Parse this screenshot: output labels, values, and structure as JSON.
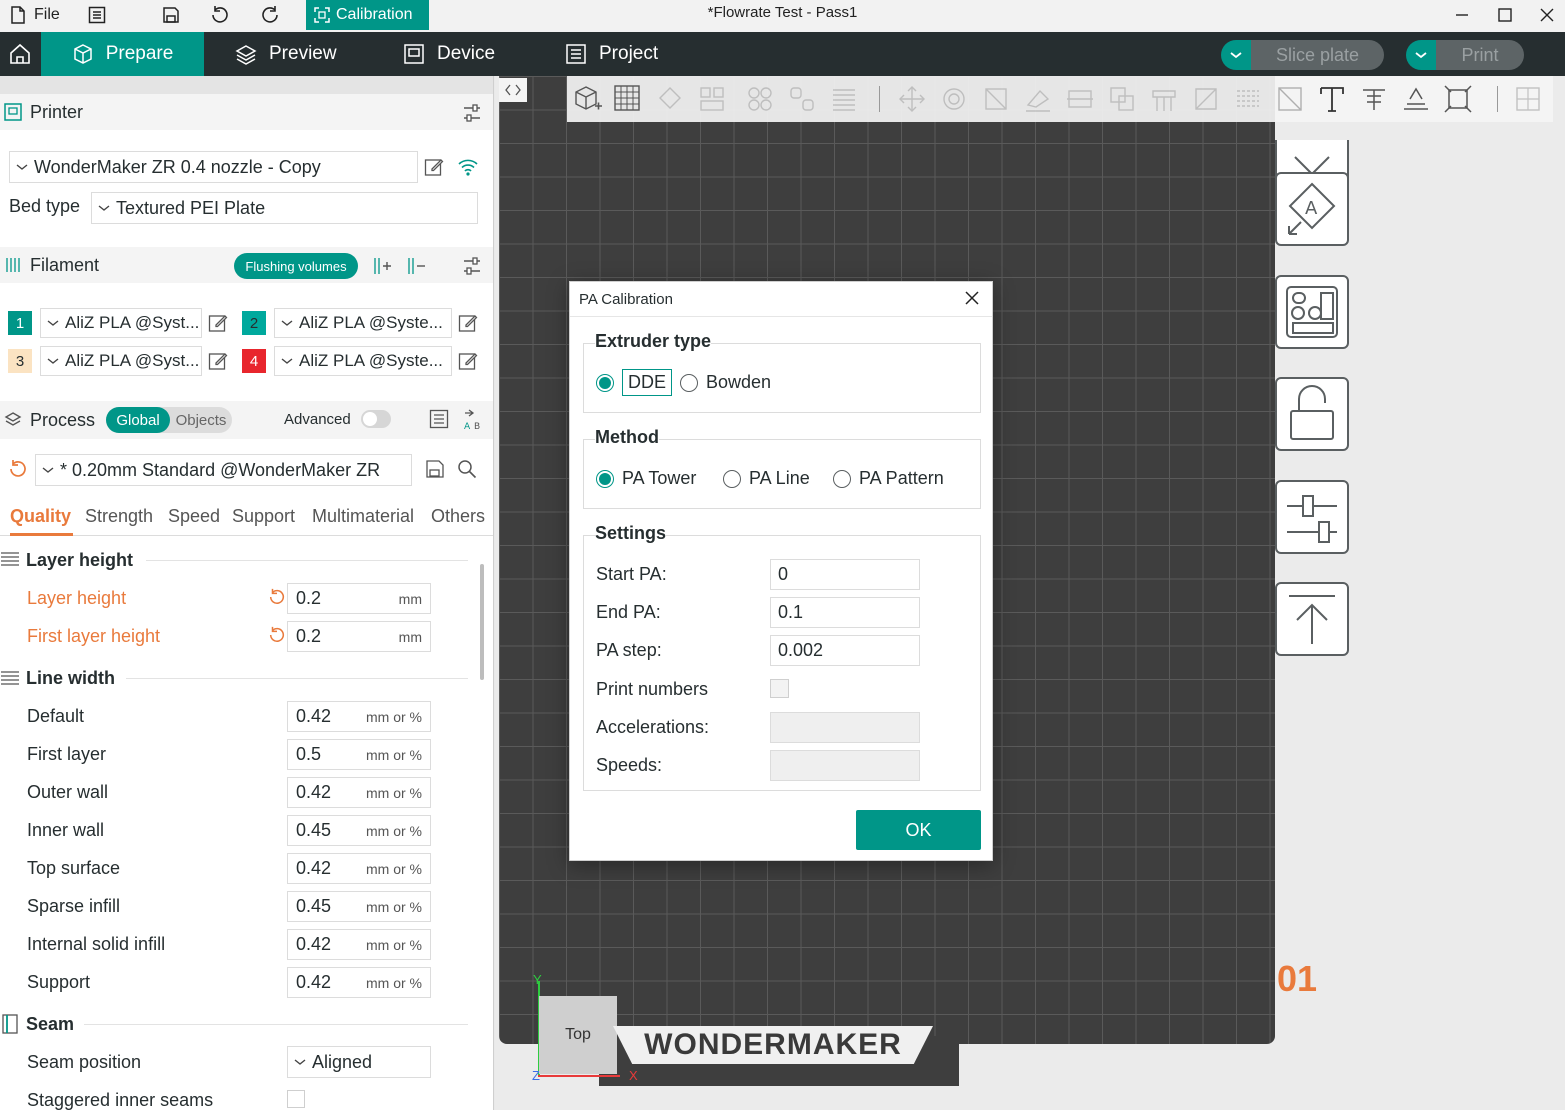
{
  "titlebar": {
    "file_label": "File",
    "calibration_label": "Calibration",
    "window_title": "*Flowrate Test - Pass1"
  },
  "nav": {
    "tabs": [
      {
        "label": "Prepare",
        "icon": "cube-icon"
      },
      {
        "label": "Preview",
        "icon": "layers-icon"
      },
      {
        "label": "Device",
        "icon": "device-icon"
      },
      {
        "label": "Project",
        "icon": "project-icon"
      }
    ],
    "slice_label": "Slice plate",
    "print_label": "Print"
  },
  "printer": {
    "section_label": "Printer",
    "selected": "WonderMaker ZR 0.4 nozzle - Copy",
    "bed_type_label": "Bed type",
    "bed_type_value": "Textured PEI Plate"
  },
  "filament": {
    "section_label": "Filament",
    "flushing_label": "Flushing volumes",
    "slots": [
      {
        "num": "1",
        "name": "AliZ PLA @Syst...",
        "color": "#009688",
        "text_color": "#ffffff"
      },
      {
        "num": "2",
        "name": "AliZ PLA @Syste...",
        "color": "#00a99d",
        "text_color": "#262e30"
      },
      {
        "num": "3",
        "name": "AliZ PLA @Syst...",
        "color": "#fbe3c2",
        "text_color": "#262e30"
      },
      {
        "num": "4",
        "name": "AliZ PLA @Syste...",
        "color": "#e8262d",
        "text_color": "#ffffff"
      }
    ]
  },
  "process": {
    "section_label": "Process",
    "global_label": "Global",
    "objects_label": "Objects",
    "advanced_label": "Advanced",
    "preset": "* 0.20mm Standard @WonderMaker ZR",
    "tabs": [
      "Quality",
      "Strength",
      "Speed",
      "Support",
      "Multimaterial",
      "Others"
    ]
  },
  "quality": {
    "layer_height_title": "Layer height",
    "layer_height_label": "Layer height",
    "layer_height_value": "0.2",
    "first_layer_height_label": "First layer height",
    "first_layer_height_value": "0.2",
    "unit_mm": "mm",
    "line_width_title": "Line width",
    "unit_mm_pct": "mm or %",
    "line_widths": [
      {
        "label": "Default",
        "value": "0.42"
      },
      {
        "label": "First layer",
        "value": "0.5"
      },
      {
        "label": "Outer wall",
        "value": "0.42"
      },
      {
        "label": "Inner wall",
        "value": "0.45"
      },
      {
        "label": "Top surface",
        "value": "0.42"
      },
      {
        "label": "Sparse infill",
        "value": "0.45"
      },
      {
        "label": "Internal solid infill",
        "value": "0.42"
      },
      {
        "label": "Support",
        "value": "0.42"
      }
    ],
    "seam_title": "Seam",
    "seam_position_label": "Seam position",
    "seam_position_value": "Aligned",
    "staggered_label": "Staggered inner seams"
  },
  "viewport": {
    "plate_number": "01",
    "view_cube_label": "Top",
    "brand": "WONDERMAKER",
    "axis_y": "Y",
    "axis_x": "X",
    "axis_z": "Z"
  },
  "dialog": {
    "title": "PA Calibration",
    "extruder_title": "Extruder type",
    "extruder_options": [
      "DDE",
      "Bowden"
    ],
    "extruder_selected": "DDE",
    "method_title": "Method",
    "method_options": [
      "PA Tower",
      "PA Line",
      "PA Pattern"
    ],
    "method_selected": "PA Tower",
    "settings_title": "Settings",
    "start_pa_label": "Start PA:",
    "start_pa_value": "0",
    "end_pa_label": "End PA:",
    "end_pa_value": "0.1",
    "pa_step_label": "PA step:",
    "pa_step_value": "0.002",
    "print_numbers_label": "Print numbers",
    "accelerations_label": "Accelerations:",
    "speeds_label": "Speeds:",
    "ok_label": "OK"
  },
  "colors": {
    "accent": "#009688",
    "changed": "#e97a3c",
    "dark_bar": "#262e30"
  }
}
